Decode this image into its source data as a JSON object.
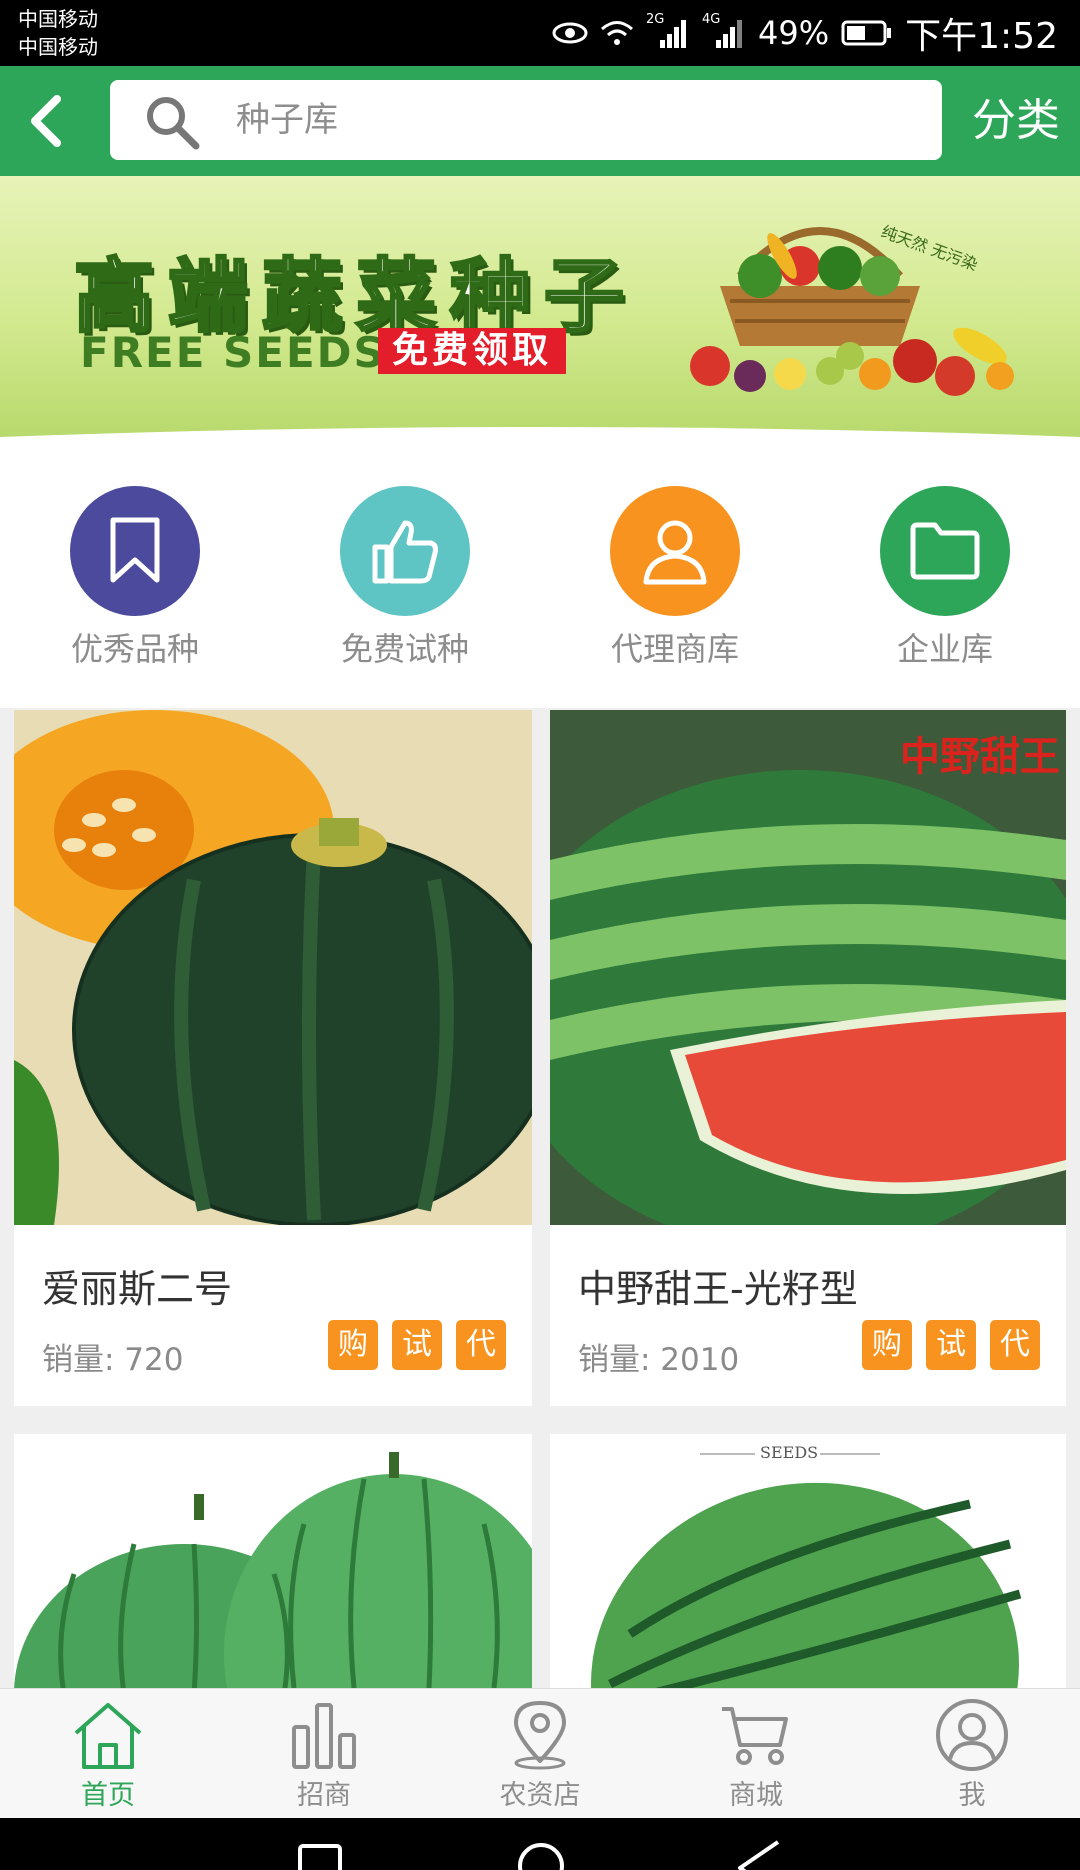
{
  "status_bar": {
    "carrier_1": "中国移动",
    "carrier_2": "中国移动",
    "signal_2g": "2G",
    "signal_4g": "4G",
    "battery": "49%",
    "time": "下午1:52"
  },
  "header": {
    "search_placeholder": "种子库",
    "category_label": "分类"
  },
  "banner": {
    "title": "高端蔬菜种子",
    "subtitle": "FREE SEEDS",
    "tag": "免费领取",
    "art_text": "纯天然 无污染"
  },
  "quick_nav": [
    {
      "label": "优秀品种",
      "icon": "bookmark-icon",
      "color": "#4b4a9c"
    },
    {
      "label": "免费试种",
      "icon": "thumbs-up-icon",
      "color": "#5ec4c4"
    },
    {
      "label": "代理商库",
      "icon": "user-icon",
      "color": "#f7931e"
    },
    {
      "label": "企业库",
      "icon": "folder-icon",
      "color": "#2ea65a"
    }
  ],
  "products": [
    {
      "name": "爱丽斯二号",
      "sales": "销量: 720",
      "badges": [
        "购",
        "试",
        "代"
      ],
      "image": "pumpkin"
    },
    {
      "name": "中野甜王-光籽型",
      "sales": "销量: 2010",
      "badges": [
        "购",
        "试",
        "代"
      ],
      "image": "watermelon",
      "image_text": "中野甜王"
    }
  ],
  "products_partial": [
    {
      "image": "watermelons"
    },
    {
      "image": "watermelon",
      "image_text": "SEEDS"
    }
  ],
  "tabs": [
    {
      "label": "首页",
      "icon": "home-icon",
      "active": true
    },
    {
      "label": "招商",
      "icon": "bar-chart-icon",
      "active": false
    },
    {
      "label": "农资店",
      "icon": "map-pin-icon",
      "active": false
    },
    {
      "label": "商城",
      "icon": "cart-icon",
      "active": false
    },
    {
      "label": "我",
      "icon": "user-icon",
      "active": false
    }
  ],
  "colors": {
    "brand_green": "#2ea65a",
    "badge_orange": "#f7931e",
    "banner_red": "#e41d2b"
  }
}
